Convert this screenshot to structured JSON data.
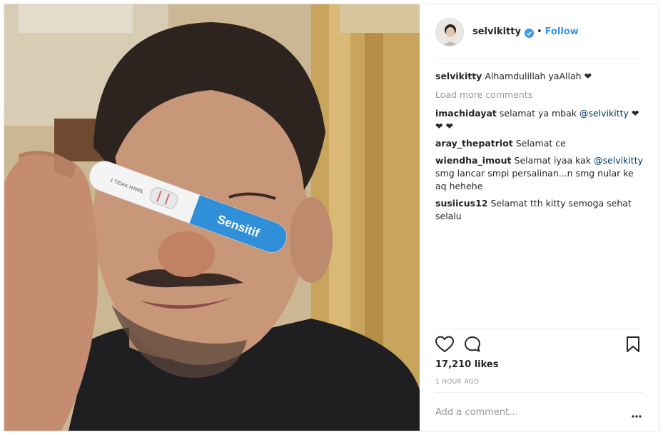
{
  "post": {
    "username": "selvikitty",
    "follow_label": "Follow",
    "dot": "•",
    "caption_user": "selvikitty",
    "caption_text": "Alhamdulillah yaAllah ❤",
    "load_more": "Load more comments",
    "comments": [
      {
        "user": "imachidayat",
        "text": "selamat ya mbak ",
        "mention": "@selvikitty",
        "tail": " ❤❤ ❤"
      },
      {
        "user": "aray_thepatriot",
        "text": "Selamat ce",
        "mention": "",
        "tail": ""
      },
      {
        "user": "wiendha_imout",
        "text": "Selamat iyaa kak ",
        "mention": "@selvikitty",
        "tail": " smg lancar smpi persalinan...n smg nular ke aq hehehe"
      },
      {
        "user": "susiicus12",
        "text": "Selamat tth kitty semoga sehat selalu",
        "mention": "",
        "tail": ""
      }
    ],
    "likes": "17,210 likes",
    "time": "1 HOUR AGO",
    "comment_placeholder": "Add a comment...",
    "more_label": "•••"
  },
  "photo": {
    "test_brand": "Sensitif",
    "test_small_text": "1 TIDAK HAMIL"
  },
  "icons": {
    "verified": "verified-badge-icon",
    "like": "heart-icon",
    "comment": "comment-bubble-icon",
    "save": "bookmark-icon",
    "more": "more-options-icon"
  },
  "colors": {
    "accent": "#3897f0",
    "text": "#262626",
    "muted": "#999999",
    "test_blue": "#2f8fd8"
  }
}
